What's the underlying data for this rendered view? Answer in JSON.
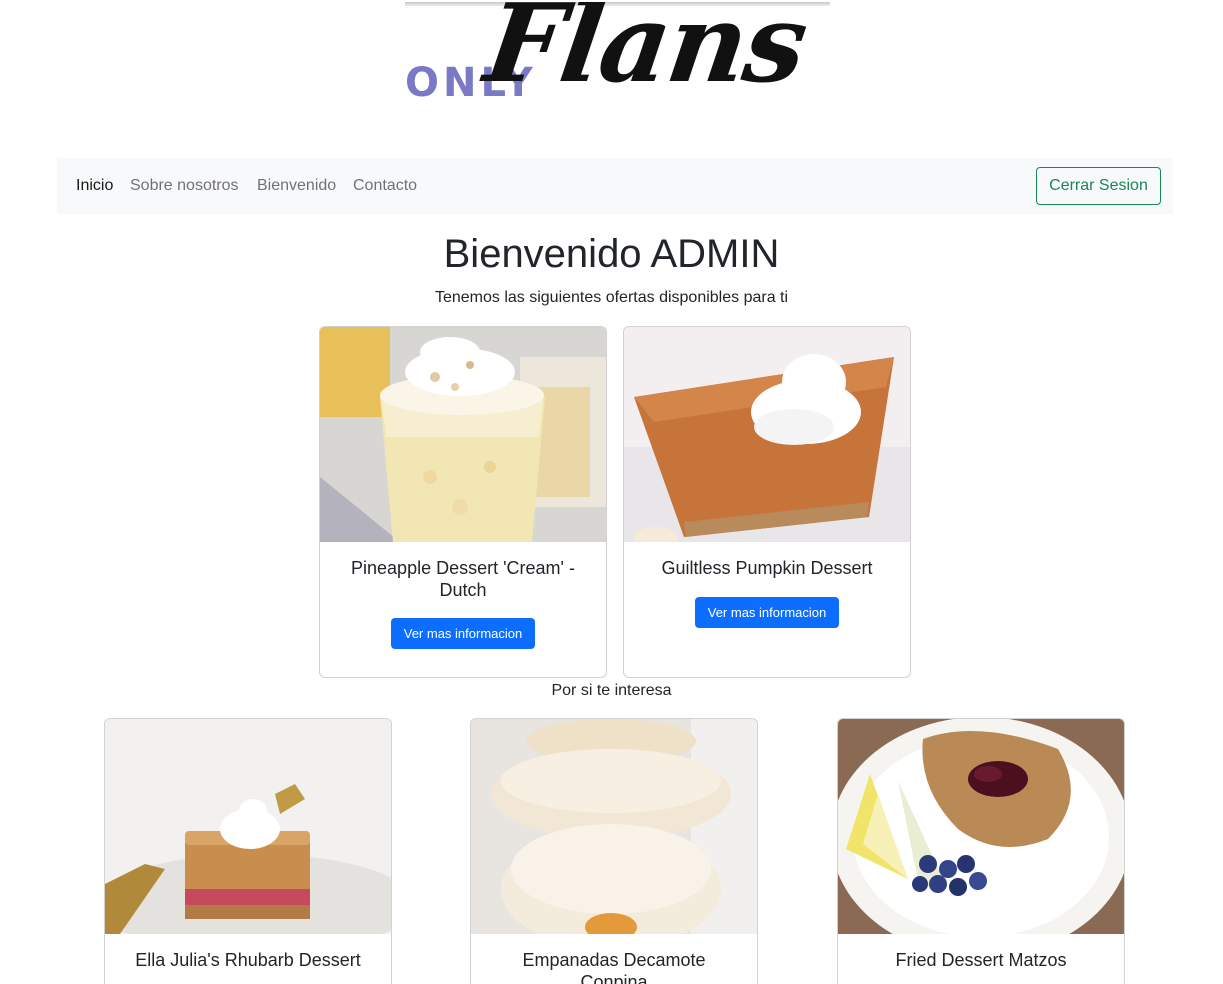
{
  "logo": {
    "prefix": "ONLY",
    "name": "Flans"
  },
  "nav": {
    "items": [
      {
        "label": "Inicio"
      },
      {
        "label": "Sobre nosotros"
      },
      {
        "label": "Bienvenido"
      },
      {
        "label": "Contacto"
      }
    ],
    "logout_label": "Cerrar Sesion"
  },
  "welcome": {
    "title": "Bienvenido ADMIN",
    "subtitle": "Tenemos las siguientes ofertas disponibles para ti"
  },
  "offers": [
    {
      "title": "Pineapple Dessert 'Cream' - Dutch",
      "button": "Ver mas informacion"
    },
    {
      "title": "Guiltless Pumpkin Dessert",
      "button": "Ver mas informacion"
    }
  ],
  "interest_heading": "Por si te interesa",
  "suggestions": [
    {
      "title": "Ella Julia's Rhubarb Dessert"
    },
    {
      "title": "Empanadas Decamote Conpina"
    },
    {
      "title": "Fried Dessert Matzos"
    }
  ],
  "colors": {
    "primary": "#0d6efd",
    "success": "#198754",
    "navbar_bg": "#f8f9fa",
    "logo_accent": "#7a79c6"
  }
}
